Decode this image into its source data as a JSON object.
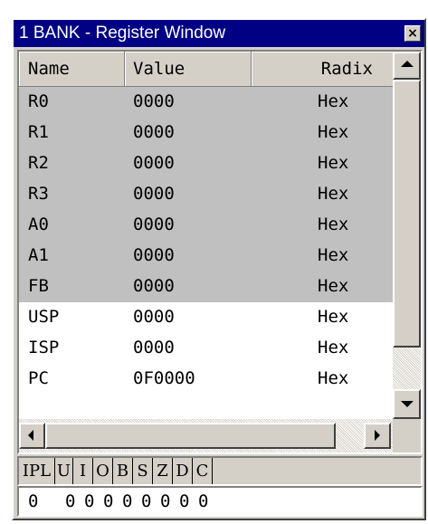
{
  "window": {
    "title": "1 BANK - Register Window",
    "close_glyph": "×"
  },
  "columns": {
    "name": "Name",
    "value": "Value",
    "radix": "Radix"
  },
  "registers": [
    {
      "name": "R0",
      "value": "0000",
      "radix": "Hex",
      "shaded": true
    },
    {
      "name": "R1",
      "value": "0000",
      "radix": "Hex",
      "shaded": true
    },
    {
      "name": "R2",
      "value": "0000",
      "radix": "Hex",
      "shaded": true
    },
    {
      "name": "R3",
      "value": "0000",
      "radix": "Hex",
      "shaded": true
    },
    {
      "name": "A0",
      "value": "0000",
      "radix": "Hex",
      "shaded": true
    },
    {
      "name": "A1",
      "value": "0000",
      "radix": "Hex",
      "shaded": true
    },
    {
      "name": "FB",
      "value": "0000",
      "radix": "Hex",
      "shaded": true
    },
    {
      "name": "USP",
      "value": "0000",
      "radix": "Hex",
      "shaded": false
    },
    {
      "name": "ISP",
      "value": "0000",
      "radix": "Hex",
      "shaded": false
    },
    {
      "name": "PC",
      "value": "0F0000",
      "radix": "Hex",
      "shaded": false
    }
  ],
  "flags": {
    "labels": [
      "IPL",
      "U",
      "I",
      "O",
      "B",
      "S",
      "Z",
      "D",
      "C"
    ],
    "values": [
      "0",
      "0",
      "0",
      "0",
      "0",
      "0",
      "0",
      "0",
      "0"
    ]
  },
  "colors": {
    "titlebar": "#000084",
    "face": "#d4d0c8",
    "shaded_row": "#c0c0c0"
  },
  "icons": {
    "close": "close-icon",
    "scroll_up": "arrow-up-icon",
    "scroll_down": "arrow-down-icon",
    "scroll_left": "arrow-left-icon",
    "scroll_right": "arrow-right-icon"
  }
}
